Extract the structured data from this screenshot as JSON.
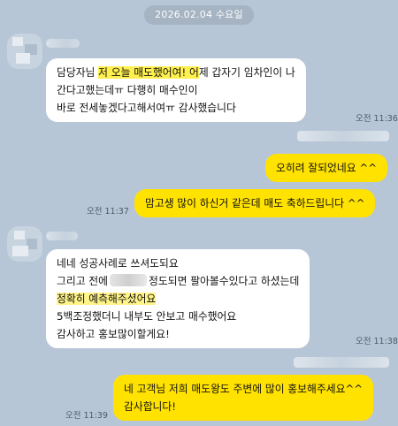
{
  "date_divider": "2026.02.04 수요일",
  "messages": [
    {
      "direction": "incoming",
      "lines": [
        {
          "segments": [
            {
              "text": "담당자님 "
            },
            {
              "text": "저 오늘 매도했어여! 어",
              "highlight": true
            },
            {
              "text": "제 갑자기 임차인이 나"
            }
          ]
        },
        {
          "segments": [
            {
              "text": "간다고했는데ㅠ 다행히 매수인이"
            }
          ]
        },
        {
          "segments": [
            {
              "text": "바로 전세놓겠다고해서여ㅠ 감사했습니다"
            }
          ]
        }
      ],
      "time": "오전 11:36"
    },
    {
      "direction": "outgoing",
      "text": "오히려 잘되었네요 ^^",
      "time": ""
    },
    {
      "direction": "outgoing",
      "text": "맘고생 많이 하신거 같은데 매도 축하드립니다 ^^",
      "time": "오전 11:37"
    },
    {
      "direction": "incoming",
      "lines": [
        {
          "segments": [
            {
              "text": "네네 성공사례로 쓰셔도되요"
            }
          ]
        },
        {
          "segments": [
            {
              "text": "그리고 전에"
            },
            {
              "redacted": true
            },
            {
              "text": "정도되면 팔아볼수있다고 하셨는데"
            }
          ]
        },
        {
          "segments": [
            {
              "text": "정확히 예측해주셨어요",
              "highlight": true
            }
          ]
        },
        {
          "segments": [
            {
              "text": "5백조정했더니 내부도 안보고 매수했어요"
            }
          ]
        },
        {
          "segments": [
            {
              "text": "감사하고 홍보많이할게요!"
            }
          ]
        }
      ],
      "time": "오전 11:38"
    },
    {
      "direction": "outgoing",
      "lines": [
        "네 고객님 저희 매도왕도 주변에 많이 홍보해주세요^^",
        "감사합니다!"
      ],
      "time": "오전 11:39"
    }
  ],
  "icons": {
    "avatar": "profile-avatar-blurred"
  },
  "colors": {
    "background": "#b7c6d6",
    "incoming_bubble": "#ffffff",
    "outgoing_bubble": "#ffe200",
    "highlight": "#fff04f"
  }
}
